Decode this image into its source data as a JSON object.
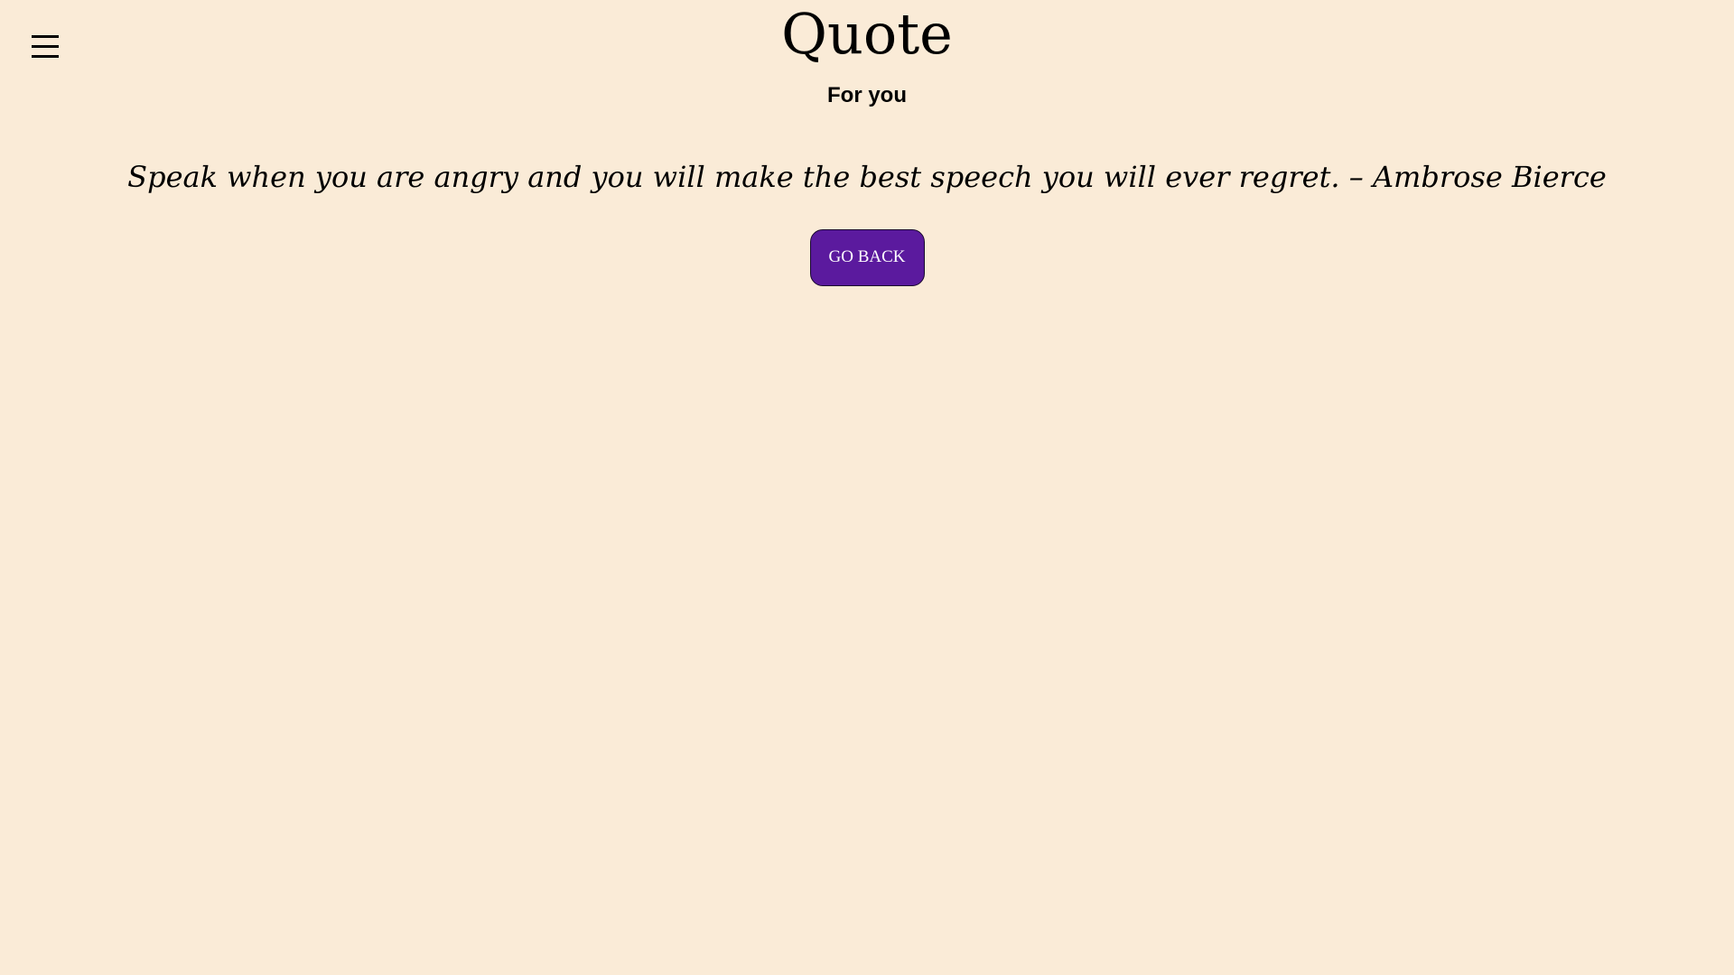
{
  "header": {
    "title": "Quote",
    "subtitle": "For you"
  },
  "menu": {
    "icon": "hamburger-menu-icon"
  },
  "quote": {
    "text": "Speak when you are angry and you will make the best speech you will ever regret. – Ambrose Bierce"
  },
  "actions": {
    "go_back_label": "GO BACK"
  },
  "colors": {
    "background": "#faebd7",
    "button": "#5b1a9e",
    "button_text": "#ffffff"
  }
}
